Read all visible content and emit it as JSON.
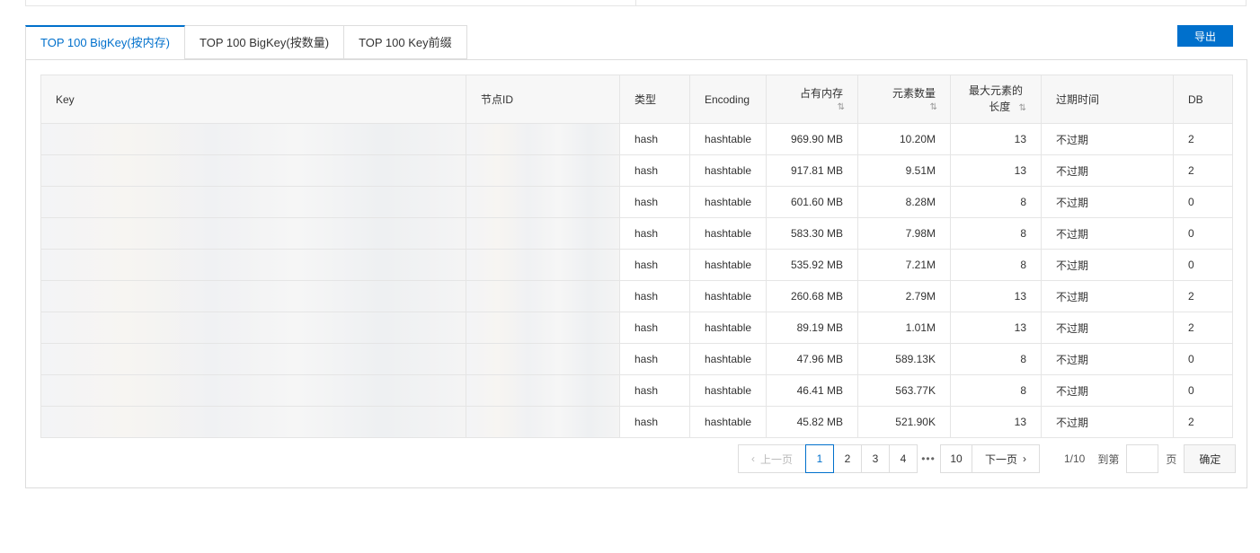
{
  "tabs": [
    {
      "label": "TOP 100 BigKey(按内存)",
      "active": true
    },
    {
      "label": "TOP 100 BigKey(按数量)",
      "active": false
    },
    {
      "label": "TOP 100 Key前缀",
      "active": false
    }
  ],
  "export_label": "导出",
  "columns": {
    "key": "Key",
    "node_id": "节点ID",
    "type": "类型",
    "encoding": "Encoding",
    "memory": "占有内存",
    "elements": "元素数量",
    "max_elem_len_line1": "最大元素的",
    "max_elem_len_line2": "长度",
    "expire": "过期时间",
    "db": "DB"
  },
  "sort_glyph": "⇅",
  "rows": [
    {
      "type": "hash",
      "encoding": "hashtable",
      "memory": "969.90 MB",
      "elements": "10.20M",
      "max_len": "13",
      "expire": "不过期",
      "db": "2"
    },
    {
      "type": "hash",
      "encoding": "hashtable",
      "memory": "917.81 MB",
      "elements": "9.51M",
      "max_len": "13",
      "expire": "不过期",
      "db": "2"
    },
    {
      "type": "hash",
      "encoding": "hashtable",
      "memory": "601.60 MB",
      "elements": "8.28M",
      "max_len": "8",
      "expire": "不过期",
      "db": "0"
    },
    {
      "type": "hash",
      "encoding": "hashtable",
      "memory": "583.30 MB",
      "elements": "7.98M",
      "max_len": "8",
      "expire": "不过期",
      "db": "0"
    },
    {
      "type": "hash",
      "encoding": "hashtable",
      "memory": "535.92 MB",
      "elements": "7.21M",
      "max_len": "8",
      "expire": "不过期",
      "db": "0"
    },
    {
      "type": "hash",
      "encoding": "hashtable",
      "memory": "260.68 MB",
      "elements": "2.79M",
      "max_len": "13",
      "expire": "不过期",
      "db": "2"
    },
    {
      "type": "hash",
      "encoding": "hashtable",
      "memory": "89.19 MB",
      "elements": "1.01M",
      "max_len": "13",
      "expire": "不过期",
      "db": "2"
    },
    {
      "type": "hash",
      "encoding": "hashtable",
      "memory": "47.96 MB",
      "elements": "589.13K",
      "max_len": "8",
      "expire": "不过期",
      "db": "0"
    },
    {
      "type": "hash",
      "encoding": "hashtable",
      "memory": "46.41 MB",
      "elements": "563.77K",
      "max_len": "8",
      "expire": "不过期",
      "db": "0"
    },
    {
      "type": "hash",
      "encoding": "hashtable",
      "memory": "45.82 MB",
      "elements": "521.90K",
      "max_len": "13",
      "expire": "不过期",
      "db": "2"
    }
  ],
  "pagination": {
    "prev": "上一页",
    "next": "下一页",
    "pages": [
      "1",
      "2",
      "3",
      "4"
    ],
    "ellipsis": "•••",
    "last": "10",
    "current": "1",
    "summary": "1/10",
    "goto_label": "到第",
    "page_unit": "页",
    "confirm": "确定"
  }
}
